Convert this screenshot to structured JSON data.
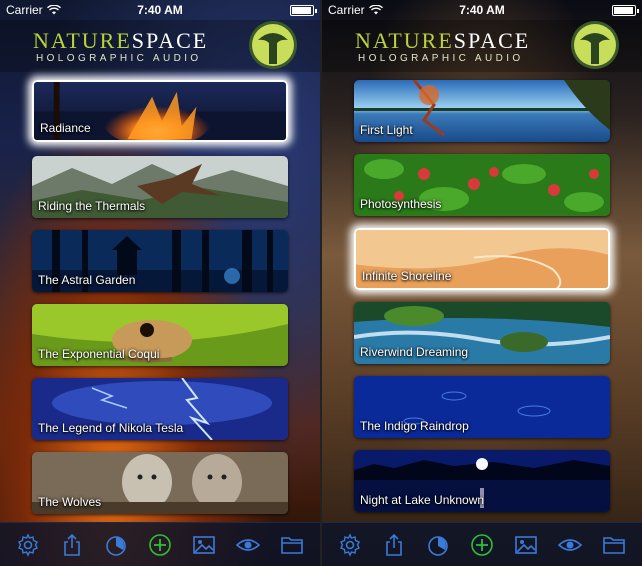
{
  "status_bar": {
    "carrier": "Carrier",
    "time": "7:40 AM"
  },
  "header": {
    "logo_nature": "NATURE",
    "logo_space": "SPACE",
    "logo_sub": "HOLOGRAPHIC AUDIO"
  },
  "left_list": [
    {
      "label": "Radiance",
      "selected": true
    },
    {
      "label": "Riding the Thermals"
    },
    {
      "label": "The Astral Garden"
    },
    {
      "label": "The Exponential Coqui"
    },
    {
      "label": "The Legend of Nikola Tesla"
    },
    {
      "label": "The Wolves"
    }
  ],
  "right_list": [
    {
      "label": "First Light"
    },
    {
      "label": "Photosynthesis"
    },
    {
      "label": "Infinite Shoreline",
      "selected": true
    },
    {
      "label": "Riverwind Dreaming"
    },
    {
      "label": "The Indigo Raindrop"
    },
    {
      "label": "Night at Lake Unknown"
    }
  ],
  "toolbar_icons": [
    "gear-icon",
    "share-icon",
    "timer-icon",
    "add-icon",
    "image-icon",
    "eye-icon",
    "folder-icon"
  ],
  "colors": {
    "accent_blue": "#3a7ad8",
    "accent_green": "#2fbf3a",
    "logo_green": "#b9d33a"
  }
}
